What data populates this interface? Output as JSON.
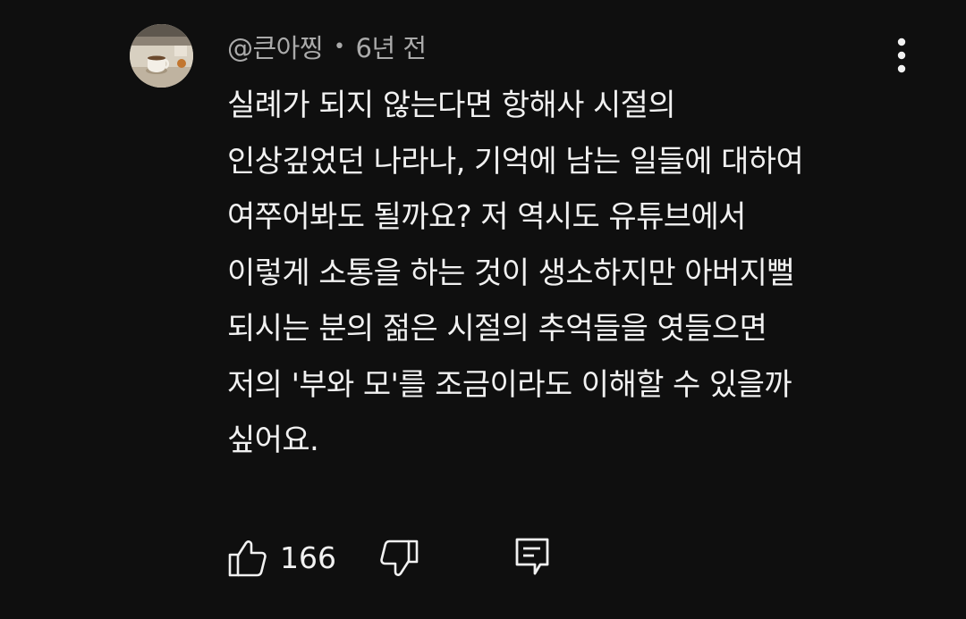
{
  "comment": {
    "author": "@큰아찡",
    "separator": "•",
    "time_ago": "6년 전",
    "text_lines": [
      "실례가 되지 않는다면 항해사 시절의",
      "인상깊었던 나라나, 기억에 남는 일들에 대하여",
      "여쭈어봐도 될까요? 저 역시도 유튜브에서",
      "이렇게 소통을 하는 것이 생소하지만 아버지뻘",
      "되시는 분의 젊은 시절의 추억들을 엿들으면",
      "저의 '부와 모'를 조금이라도 이해할 수 있을까",
      "싶어요."
    ],
    "like_count": "166"
  },
  "icons": {
    "avatar": "avatar-coffee-cup",
    "menu": "more-vert-icon",
    "like": "thumbs-up-icon",
    "dislike": "thumbs-down-icon",
    "reply": "comment-reply-icon"
  },
  "colors": {
    "background": "#0f0f0f",
    "primary_text": "#f1f1f1",
    "secondary_text": "#aaaaaa"
  }
}
